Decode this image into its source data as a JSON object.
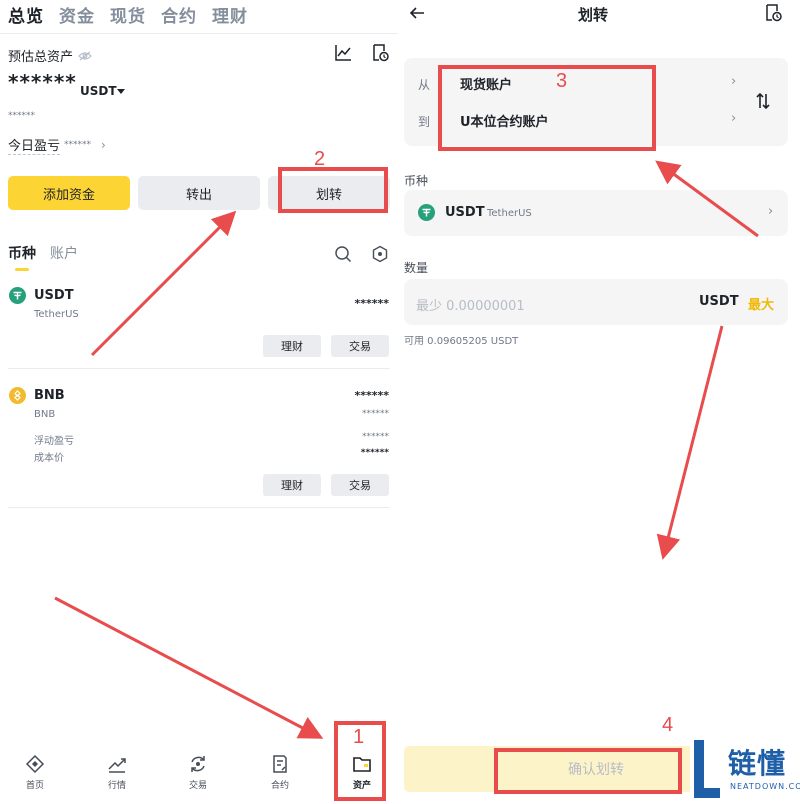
{
  "left": {
    "top_tabs": [
      "总览",
      "资金",
      "现货",
      "合约",
      "理财"
    ],
    "est_label": "预估总资产",
    "balance": "******",
    "balance_unit": "USDT",
    "balance_sub": "******",
    "pnl_label": "今日盈亏",
    "pnl_value": "******",
    "buttons": {
      "add_funds": "添加资金",
      "withdraw": "转出",
      "transfer": "划转"
    },
    "sub_tabs": [
      "币种",
      "账户"
    ],
    "coins": [
      {
        "symbol": "USDT",
        "name": "TetherUS",
        "value": "******",
        "actions": [
          "理财",
          "交易"
        ]
      },
      {
        "symbol": "BNB",
        "name": "BNB",
        "value": "******",
        "value_sub": "******",
        "floating_label": "浮动盈亏",
        "floating_value": "******",
        "cost_label": "成本价",
        "cost_value": "******",
        "actions": [
          "理财",
          "交易"
        ]
      }
    ],
    "nav": [
      "首页",
      "行情",
      "交易",
      "合约",
      "资产"
    ]
  },
  "right": {
    "title": "划转",
    "from_label": "从",
    "from_value": "现货账户",
    "to_label": "到",
    "to_value": "U本位合约账户",
    "currency_label": "币种",
    "currency_symbol": "USDT",
    "currency_name": "TetherUS",
    "amount_label": "数量",
    "amount_placeholder": "最少 0.00000001",
    "amount_unit": "USDT",
    "max_label": "最大",
    "available": "可用 0.09605205 USDT",
    "confirm": "确认划转"
  },
  "annotations": [
    "1",
    "2",
    "3",
    "4"
  ],
  "watermark": {
    "text": "链懂",
    "sub": "NEATDOWN.COM"
  },
  "colors": {
    "accent_yellow": "#fcd535",
    "max_yellow": "#f0b90b",
    "annotation_red": "#e84c4c",
    "usdt_green": "#26a17b",
    "bnb_yellow": "#f3ba2f",
    "watermark_blue": "#1f5fa8"
  }
}
